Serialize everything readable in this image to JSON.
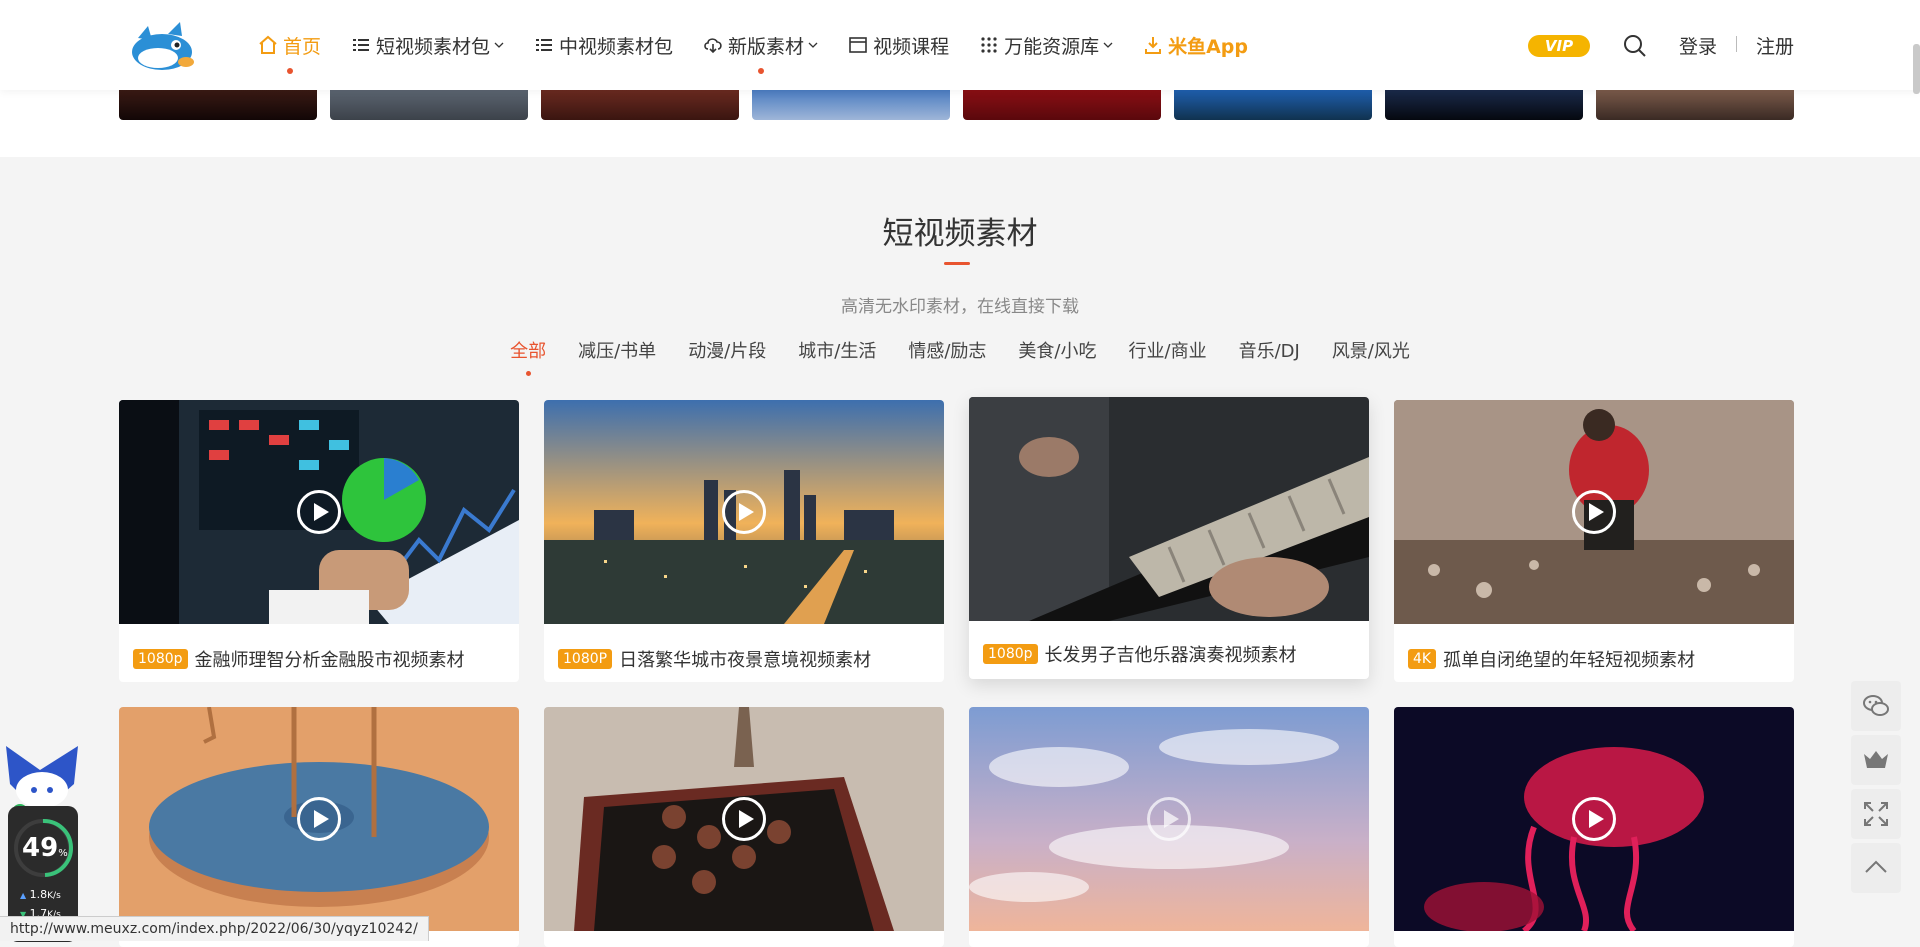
{
  "header": {
    "nav": [
      {
        "label": "首页",
        "icon": "home-icon"
      },
      {
        "label": "短视频素材包",
        "icon": "list-icon"
      },
      {
        "label": "中视频素材包",
        "icon": "list-icon"
      },
      {
        "label": "新版素材",
        "icon": "cloud-download-icon"
      },
      {
        "label": "视频课程",
        "icon": "video-window-icon"
      },
      {
        "label": "万能资源库",
        "icon": "grid-icon"
      },
      {
        "label": "米鱼App",
        "icon": "download-icon"
      }
    ],
    "vip": "VIP",
    "login": "登录",
    "register": "注册"
  },
  "section": {
    "title": "短视频素材",
    "subtitle": "高清无水印素材，在线直接下载",
    "categories": [
      "全部",
      "减压/书单",
      "动漫/片段",
      "城市/生活",
      "情感/励志",
      "美食/小吃",
      "行业/商业",
      "音乐/DJ",
      "风景/风光"
    ]
  },
  "cards": [
    {
      "res": "1080p",
      "title": "金融师理智分析金融股市视频素材"
    },
    {
      "res": "1080P",
      "title": "日落繁华城市夜景意境视频素材"
    },
    {
      "res": "1080p",
      "title": "长发男子吉他乐器演奏视频素材"
    },
    {
      "res": "4K",
      "title": "孤单自闭绝望的年轻短视频素材"
    },
    {
      "res": "",
      "title": ""
    },
    {
      "res": "",
      "title": ""
    },
    {
      "res": "",
      "title": ""
    },
    {
      "res": "",
      "title": ""
    }
  ],
  "widget": {
    "percent": "49",
    "percent_unit": "%",
    "up": "1.8",
    "down": "1.7",
    "speed_unit": "K/s"
  },
  "status_url": "http://www.meuxz.com/index.php/2022/06/30/yqyz10242/",
  "colors": {
    "accent": "#f39c12",
    "active_red": "#e8542f"
  }
}
